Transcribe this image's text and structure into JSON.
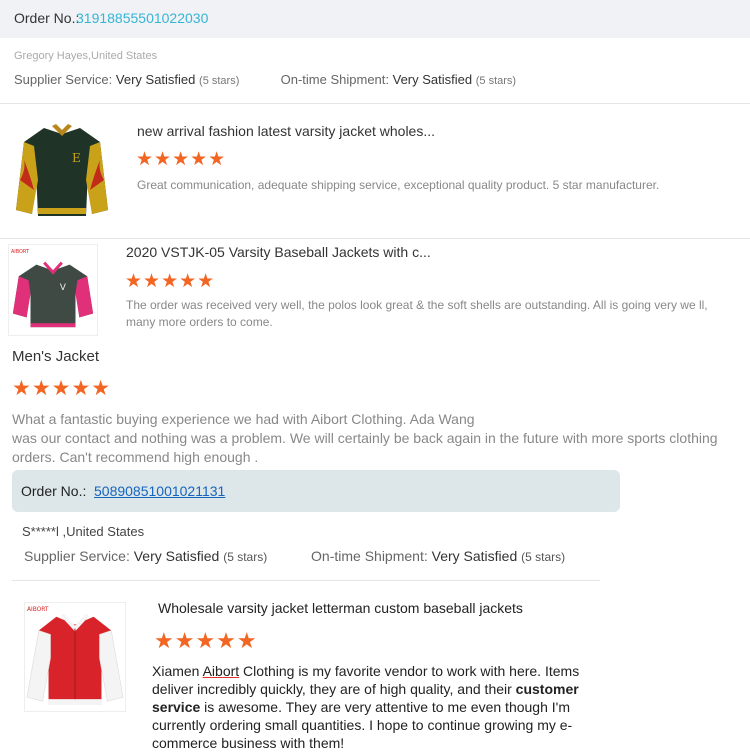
{
  "order1": {
    "label": "Order No.:",
    "number": "31918855501022030"
  },
  "feedback1": {
    "buyer": "Gregory Hayes,United States",
    "supplier_label": "Supplier Service:",
    "supplier_value": "Very Satisfied",
    "supplier_stars": "(5 stars)",
    "shipment_label": "On-time Shipment:",
    "shipment_value": "Very Satisfied",
    "shipment_stars": "(5 stars)"
  },
  "products": [
    {
      "title": "new arrival fashion latest varsity jacket wholes...",
      "rating": 5,
      "review": "Great communication, adequate shipping service, exceptional quality product. 5 star manufacturer."
    },
    {
      "title": "2020 VSTJK-05 Varsity Baseball Jackets with c...",
      "rating": 5,
      "review": "The order was received very well, the polos look great & the soft shells are outstanding. All is going very we ll, many more orders to come."
    }
  ],
  "mens_jacket": {
    "title": "Men's Jacket",
    "rating": 5,
    "review_line1": "What a fantastic buying experience we had with Aibort Clothing. Ada Wang",
    "review_line2": "was our contact and nothing was a problem. We will certainly be back again in the future with more sports clothing orders. Can't recommend high enough ."
  },
  "order2": {
    "label": "Order No.:",
    "number": "50890851001021131"
  },
  "feedback2": {
    "buyer": "S*****l ,United States",
    "supplier_label": "Supplier Service:",
    "supplier_value": "Very Satisfied",
    "supplier_stars": "(5 stars)",
    "shipment_label": "On-time Shipment:",
    "shipment_value": "Very Satisfied",
    "shipment_stars": "(5 stars)"
  },
  "last_product": {
    "title": "Wholesale varsity jacket letterman custom baseball jackets",
    "rating": 5,
    "review_a": "Xiamen ",
    "review_b": "Aibort",
    "review_c": " Clothing is my favorite vendor to work with here. Items deliver incredibly quickly, they are of high quality, and their ",
    "review_d": "customer service",
    "review_e": " is awesome. They are very attentive to me even though I'm currently ordering small quantities. I hope to continue growing my e-commerce business with them!"
  },
  "stars_glyph": "★★★★★",
  "colors": {
    "star": "#f26522",
    "order_link": "#35b5d6",
    "order_link_2": "#1565c0"
  }
}
